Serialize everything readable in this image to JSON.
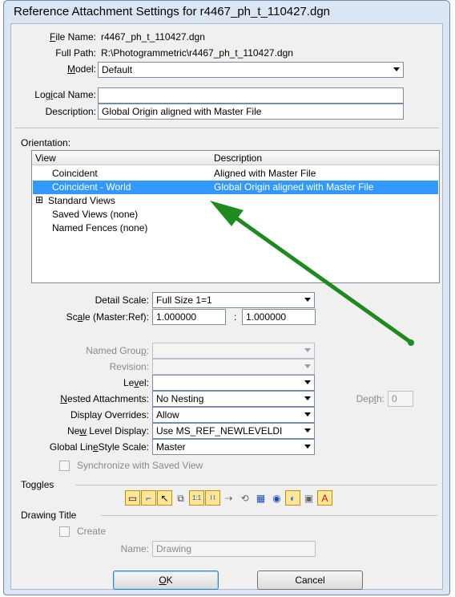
{
  "window": {
    "title": "Reference Attachment Settings for r4467_ph_t_110427.dgn"
  },
  "file": {
    "file_name_label": "File Name:",
    "file_name_value": "r4467_ph_t_110427.dgn",
    "full_path_label": "Full Path:",
    "full_path_value": "R:\\Photogrammetric\\r4467_ph_t_110427.dgn",
    "model_label": "Model:",
    "model_value": "Default",
    "logical_name_label": "Logical Name:",
    "logical_name_value": "",
    "description_label": "Description:",
    "description_value": "Global Origin aligned with Master File"
  },
  "orientation": {
    "label": "Orientation:",
    "columns": [
      "View",
      "Description"
    ],
    "rows": [
      {
        "view": "Coincident",
        "description": "Aligned with Master File",
        "selected": false
      },
      {
        "view": "Coincident - World",
        "description": "Global Origin aligned with Master File",
        "selected": true
      },
      {
        "view": "Standard Views",
        "description": "",
        "expander": "⊞"
      },
      {
        "view": "Saved Views (none)",
        "description": ""
      },
      {
        "view": "Named Fences (none)",
        "description": ""
      }
    ]
  },
  "scale": {
    "detail_scale_label": "Detail Scale:",
    "detail_scale_value": "Full Size 1=1",
    "scale_label": "Scale (Master:Ref):",
    "master_value": "1.000000",
    "separator": ":",
    "ref_value": "1.000000"
  },
  "attach": {
    "named_group_label": "Named Group:",
    "named_group_value": "",
    "revision_label": "Revision:",
    "revision_value": "",
    "level_label": "Level:",
    "level_value": "",
    "nested_label": "Nested Attachments:",
    "nested_value": "No Nesting",
    "depth_label": "Depth:",
    "depth_value": "0",
    "display_overrides_label": "Display Overrides:",
    "display_overrides_value": "Allow",
    "new_level_label": "New Level Display:",
    "new_level_value": "Use MS_REF_NEWLEVELDI",
    "linestyle_label": "Global LineStyle Scale:",
    "linestyle_value": "Master",
    "sync_label": "Synchronize with Saved View"
  },
  "toggles": {
    "label": "Toggles",
    "items": [
      {
        "name": "display",
        "glyph": "▭",
        "on": true
      },
      {
        "name": "snap",
        "glyph": "⌐",
        "on": true
      },
      {
        "name": "locate",
        "glyph": "↖",
        "on": true
      },
      {
        "name": "copy",
        "glyph": "⧉",
        "on": false
      },
      {
        "name": "true-scale",
        "glyph": "1:1",
        "on": true
      },
      {
        "name": "line-style-scale",
        "glyph": "⌇⌇",
        "on": true
      },
      {
        "name": "treat-as-element",
        "glyph": "⇢",
        "on": false
      },
      {
        "name": "ignore-attachment",
        "glyph": "⟲",
        "on": false
      },
      {
        "name": "raster",
        "glyph": "▦",
        "on": false
      },
      {
        "name": "display-raster",
        "glyph": "◉",
        "on": false
      },
      {
        "name": "use-lights",
        "glyph": "◐",
        "on": true
      },
      {
        "name": "annotation",
        "glyph": "▣",
        "on": false
      },
      {
        "name": "text-style",
        "glyph": "A",
        "on": true
      }
    ]
  },
  "drawing_title": {
    "label": "Drawing Title",
    "create_label": "Create",
    "name_label": "Name:",
    "name_value": "Drawing"
  },
  "buttons": {
    "ok": "OK",
    "cancel": "Cancel"
  },
  "colors": {
    "selection": "#3399ff",
    "arrow": "#1f8a1f",
    "frame": "#dbe6f4"
  }
}
